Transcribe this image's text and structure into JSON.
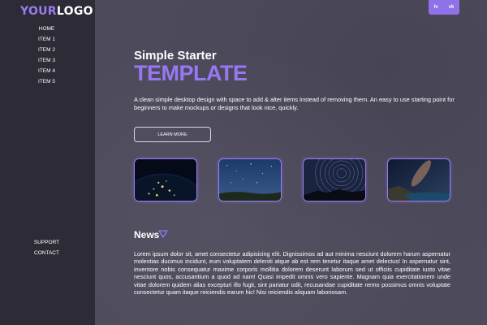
{
  "logo": {
    "part1": "YOUR",
    "part2": "LOGO"
  },
  "nav": {
    "top": [
      "HOME",
      "ITEM 1",
      "ITEM 2",
      "ITEM 3",
      "ITEM 4",
      "ITEM 5"
    ],
    "bottom": [
      "SUPPORT",
      "CONTACT"
    ]
  },
  "lang": [
    "lv",
    "vk"
  ],
  "hero": {
    "subtitle": "Simple Starter",
    "title": "TEMPLATE",
    "description": "A clean simple desktop design with space to add & alter items instead of removing them. An easy to use starting point for beginners to make mockups or designs that look nice, quickly.",
    "button": "LEARN MORE"
  },
  "gallery": [
    {
      "icon": "earth-night-image"
    },
    {
      "icon": "starry-sky-image"
    },
    {
      "icon": "star-trails-image"
    },
    {
      "icon": "milky-way-coast-image"
    }
  ],
  "news": {
    "heading": "News",
    "body": "Lorem ipsum dolor sit, amet consectetur adipisicing elit. Dignissimos ad aut minima nesciunt dolorem harum aspernatur molestias ducimus incidunt, eum voluptatem deleniti atque ab est rem tenetur itaque amet delectus! In aspernatur sint, inventore nobis consequatur maxime corporis mollitia dolorem deserunt laborum sed ut officiis cupiditate iusto vitae nesciunt quos, accusantium a quod ad nam! Quasi impedit omnis vero sapiente. Magnam quia exercitationem unde vitae dolorem quidem alias excepturi illo fugit, sint pariatur odit, recusandae cupiditate nemo possimus omnis voluptate consectetur quam itaque reiciendis earum hic! Nisi reiciendis aliquam laboriosam."
  },
  "colors": {
    "accent": "#9878f2",
    "sidebar": "#2d2b36",
    "background": "#4d4a5c"
  }
}
